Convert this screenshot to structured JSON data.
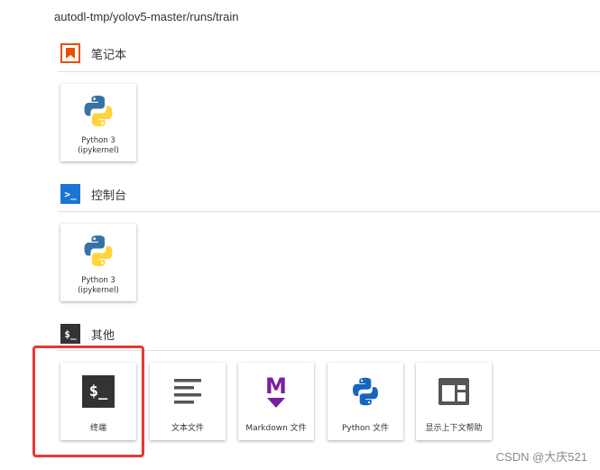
{
  "breadcrumb": {
    "path": "autodl-tmp/yolov5-master/runs/train"
  },
  "sections": {
    "notebook": {
      "title": "笔记本",
      "icon": "notebook-icon",
      "accent": "#e65100",
      "kernels": [
        {
          "label_line1": "Python 3",
          "label_line2": "(ipykernel)",
          "icon": "python-logo-icon"
        }
      ]
    },
    "console": {
      "title": "控制台",
      "icon": "console-icon",
      "accent": "#1976d2",
      "icon_text": ">_",
      "kernels": [
        {
          "label_line1": "Python 3",
          "label_line2": "(ipykernel)",
          "icon": "python-logo-icon"
        }
      ]
    },
    "other": {
      "title": "其他",
      "icon": "terminal-section-icon",
      "icon_text": "$_",
      "items": [
        {
          "label": "终端",
          "icon": "terminal-icon",
          "icon_text": "$_"
        },
        {
          "label": "文本文件",
          "icon": "text-file-icon"
        },
        {
          "label": "Markdown 文件",
          "icon": "markdown-icon",
          "icon_text": "M",
          "color": "#7b1fa2"
        },
        {
          "label": "Python 文件",
          "icon": "python-file-icon"
        },
        {
          "label": "显示上下文帮助",
          "icon": "context-help-icon"
        }
      ]
    }
  },
  "watermark": "CSDN @大庆521",
  "colors": {
    "highlight": "#e53935",
    "python_blue": "#3673a5",
    "python_yellow": "#ffd43b",
    "dark": "#333333"
  }
}
